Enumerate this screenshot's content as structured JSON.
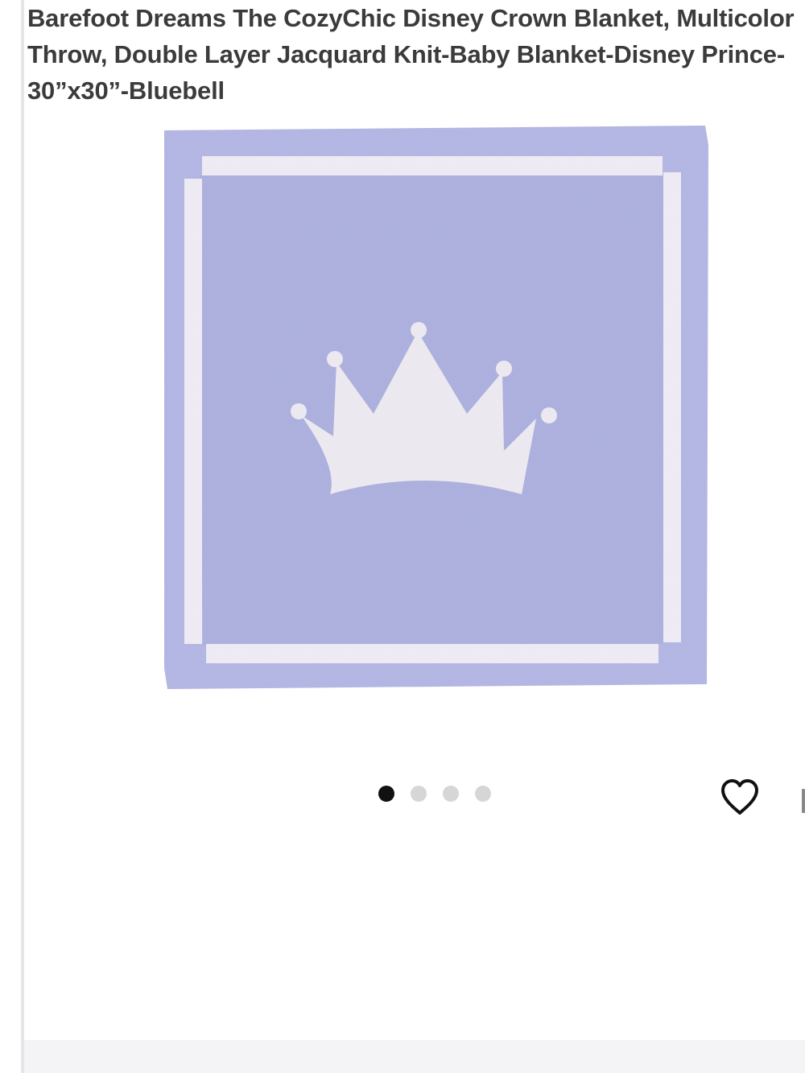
{
  "product": {
    "title": "Barefoot Dreams The CozyChic Disney Crown Blanket, Multicolor Throw, Double Layer Jacquard Knit-Baby Blanket-Disney Prince-30”x30”-Bluebell"
  },
  "gallery": {
    "image_count": 4,
    "active_index": 0
  },
  "icons": {
    "favorite": "heart-outline-icon"
  },
  "colors": {
    "blanket_main": "#a9acdd",
    "blanket_border": "#b3b5e2",
    "blanket_stripe": "#eceaf3",
    "crown": "#ebe7f0",
    "dot_active": "#111111",
    "dot_inactive": "#d6d6d6"
  }
}
